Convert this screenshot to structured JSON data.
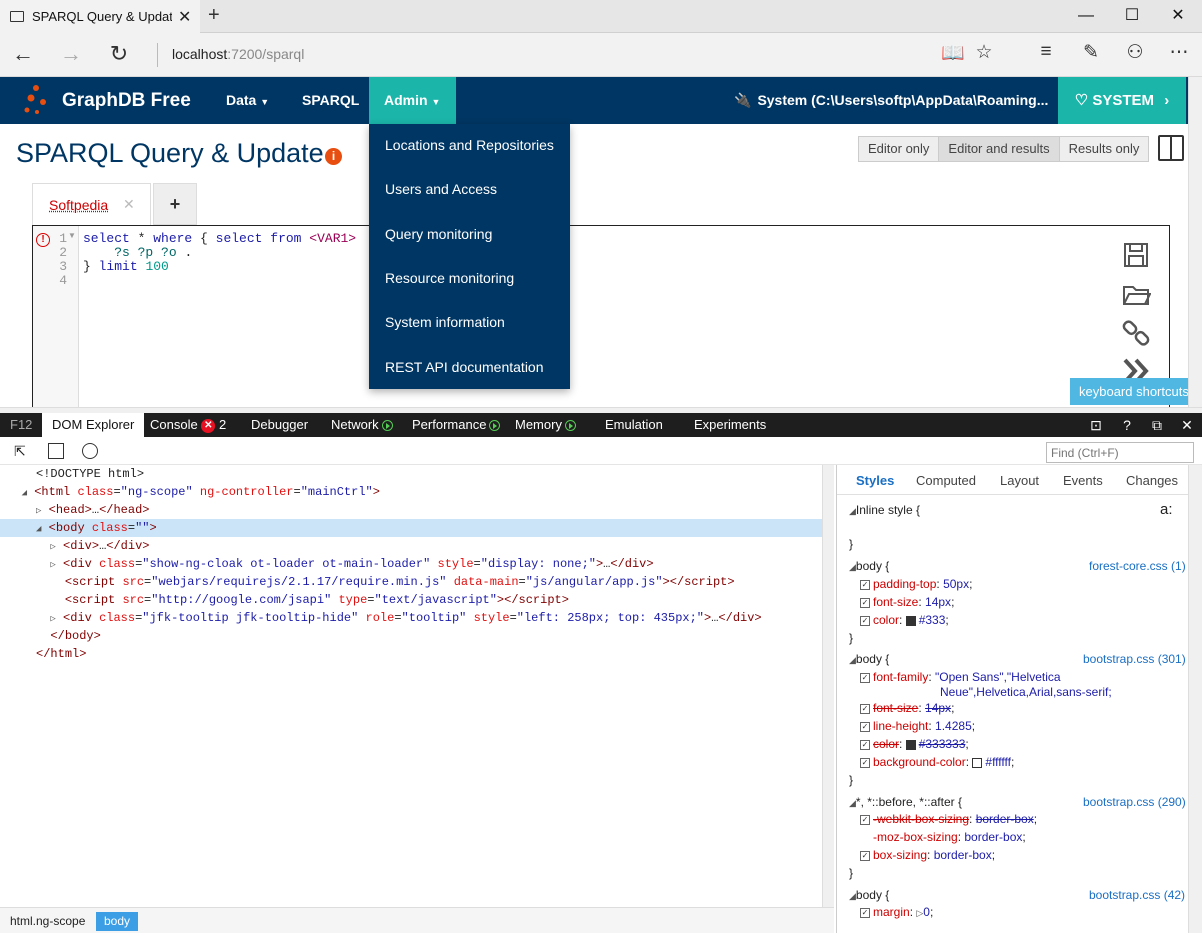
{
  "browser": {
    "tab_title": "SPARQL Query & Updat",
    "tab_close": "✕",
    "new_tab": "+",
    "url_host": "localhost",
    "url_path": ":7200/sparql",
    "min": "—",
    "max": "☐",
    "close": "✕"
  },
  "app": {
    "brand": "GraphDB Free",
    "nav": [
      "Data",
      "SPARQL",
      "Admin"
    ],
    "repo_label": "System (C:\\Users\\softp\\AppData\\Roaming...",
    "system_button": "SYSTEM"
  },
  "page": {
    "title": "SPARQL Query & Update",
    "view_buttons": [
      "Editor only",
      "Editor and results",
      "Results only"
    ],
    "active_view": "Editor and results",
    "query_tab": "Softpedia",
    "add_tab": "+",
    "line_numbers": [
      "1",
      "2",
      "3",
      "4"
    ],
    "keyboard_shortcuts": "keyboard shortcuts"
  },
  "admin_menu": [
    "Locations and Repositories",
    "Users and Access",
    "Query monitoring",
    "Resource monitoring",
    "System information",
    "REST API documentation"
  ],
  "devtools": {
    "tabs": [
      "F12",
      "DOM Explorer",
      "Console",
      "Debugger",
      "Network",
      "Performance",
      "Memory",
      "Emulation",
      "Experiments"
    ],
    "console_errors": "2",
    "find_placeholder": "Find (Ctrl+F)",
    "style_tabs": [
      "Styles",
      "Computed",
      "Layout",
      "Events",
      "Changes"
    ],
    "inline_style": "Inline style  {",
    "breadcrumbs": [
      "html.ng-scope",
      "body"
    ]
  },
  "colors": {
    "header_bg": "#003663",
    "accent": "#1cb5a9",
    "menu_bg": "#003663"
  }
}
